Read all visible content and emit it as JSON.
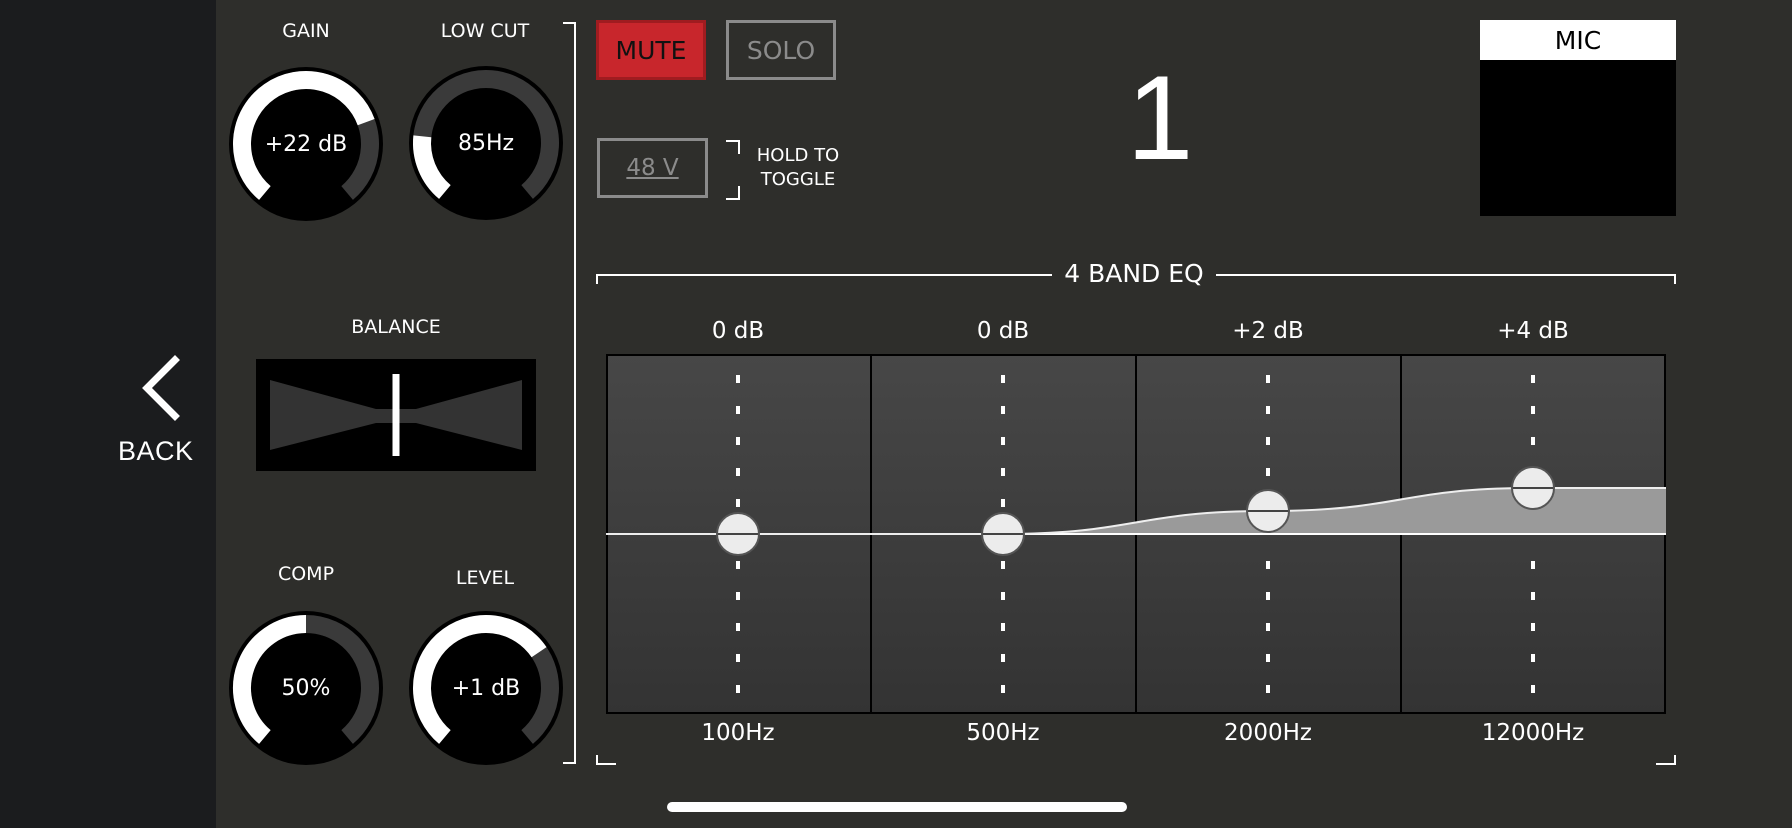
{
  "back": {
    "label": "BACK"
  },
  "knobs": {
    "gain": {
      "label": "GAIN",
      "value": "+22 dB",
      "level": 0.75
    },
    "low_cut": {
      "label": "LOW CUT",
      "value": "85Hz",
      "level": 0.2
    },
    "comp": {
      "label": "COMP",
      "value": "50%",
      "level": 0.5
    },
    "level": {
      "label": "LEVEL",
      "value": "+1 dB",
      "level": 0.7
    }
  },
  "balance": {
    "label": "BALANCE",
    "position": 0.5
  },
  "buttons": {
    "mute": "MUTE",
    "solo": "SOLO",
    "phantom": "48 V",
    "hold_hint": [
      "HOLD TO",
      "TOGGLE"
    ]
  },
  "channel": {
    "number": "1",
    "name": "MIC"
  },
  "eq": {
    "title": "4 BAND EQ",
    "bands": [
      {
        "gain": "0 dB",
        "freq": "100Hz",
        "gain_value": 0
      },
      {
        "gain": "0 dB",
        "freq": "500Hz",
        "gain_value": 0
      },
      {
        "gain": "+2 dB",
        "freq": "2000Hz",
        "gain_value": 2
      },
      {
        "gain": "+4 dB",
        "freq": "12000Hz",
        "gain_value": 4
      }
    ]
  },
  "colors": {
    "background": "#2e2e2b",
    "sidebar": "#1b1c1e",
    "mute_active": "#c8262c",
    "inactive": "#8b8b8b"
  }
}
